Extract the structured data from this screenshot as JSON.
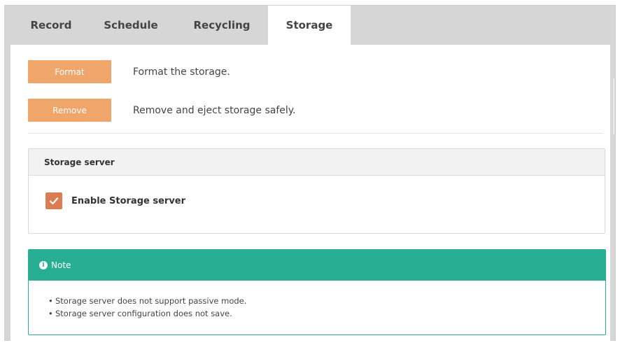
{
  "tabs": [
    {
      "label": "Record",
      "active": false
    },
    {
      "label": "Schedule",
      "active": false
    },
    {
      "label": "Recycling",
      "active": false
    },
    {
      "label": "Storage",
      "active": true
    }
  ],
  "actions": {
    "format": {
      "button": "Format",
      "description": "Format the storage."
    },
    "remove": {
      "button": "Remove",
      "description": "Remove and eject storage safely."
    }
  },
  "storage_server": {
    "title": "Storage server",
    "enable_label": "Enable Storage server",
    "enabled": true
  },
  "note": {
    "title": "Note",
    "icon": "info-icon",
    "items": [
      "Storage server does not support passive mode.",
      "Storage server configuration does not save."
    ]
  },
  "colors": {
    "button": "#f0a56b",
    "checkbox": "#db7d52",
    "note_accent": "#28ae93"
  }
}
